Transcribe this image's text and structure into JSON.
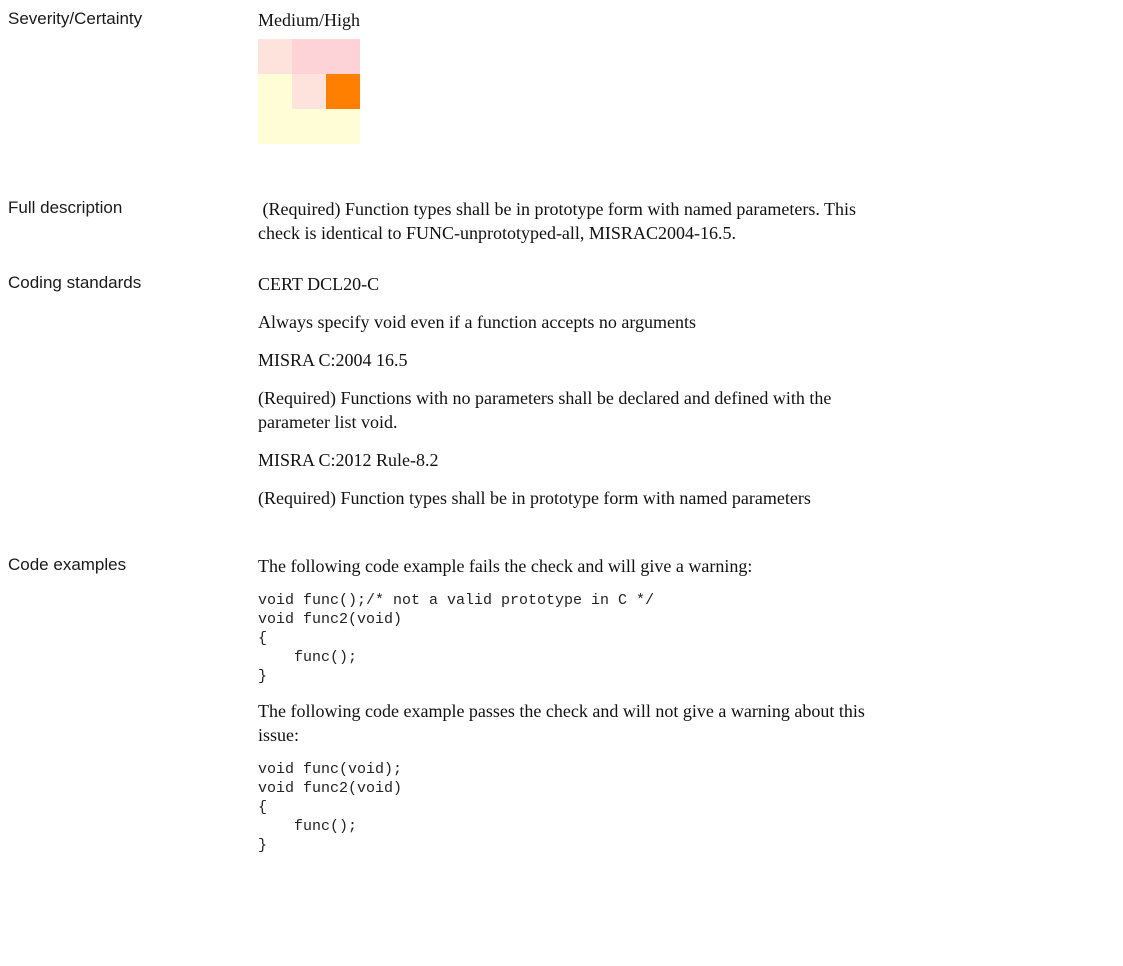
{
  "severity": {
    "label": "Severity/Certainty",
    "value": "Medium/High",
    "matrix": {
      "rows": [
        [
          "#fde3dc",
          "#fdd3d8",
          "#fdd3d8"
        ],
        [
          "#fefdd5",
          "#fde3dc",
          "#ff8000"
        ],
        [
          "#fefdd5",
          "#fefdd5",
          "#fefdd5"
        ]
      ]
    }
  },
  "full_description": {
    "label": "Full description",
    "line1": " (Required) Function types shall be in prototype form with named parameters. This",
    "line2": "check is identical to FUNC-unprototyped-all, MISRAC2004-16.5."
  },
  "coding_standards": {
    "label": "Coding standards",
    "standards": [
      {
        "name": "CERT DCL20-C",
        "desc_lines": [
          "Always specify void even if a function accepts no arguments"
        ]
      },
      {
        "name": "MISRA C:2004 16.5",
        "desc_lines": [
          "(Required) Functions with no parameters shall be declared and defined with the",
          "parameter list void."
        ]
      },
      {
        "name": "MISRA C:2012 Rule-8.2",
        "desc_lines": [
          "(Required) Function types shall be in prototype form with named parameters"
        ]
      }
    ]
  },
  "code_examples": {
    "label": "Code examples",
    "fail_intro": "The following code example fails the check and will give a warning:",
    "fail_code": "void func();/* not a valid prototype in C */\nvoid func2(void)\n{\n    func();\n}",
    "pass_intro_line1": "The following code example passes the check and will not give a warning about this",
    "pass_intro_line2": "issue:",
    "pass_code": "void func(void);\nvoid func2(void)\n{\n    func();\n}"
  }
}
